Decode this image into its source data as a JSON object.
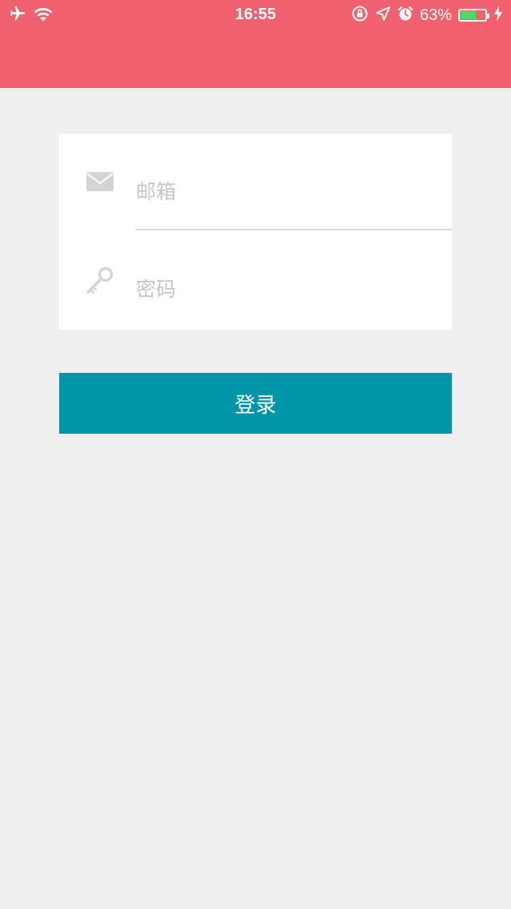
{
  "status_bar": {
    "time": "16:55",
    "battery_percent": "63%",
    "battery_level": 0.63,
    "icons": [
      "airplane-icon",
      "wifi-icon",
      "rotation-lock-icon",
      "location-icon",
      "alarm-icon",
      "battery-icon",
      "charging-icon"
    ]
  },
  "colors": {
    "header": "#f0606f",
    "background": "#efefef",
    "button": "#0095a7",
    "placeholder": "#c5c5c9",
    "battery_fill": "#4cd964"
  },
  "form": {
    "email": {
      "placeholder": "邮箱",
      "value": "",
      "icon": "envelope-icon"
    },
    "password": {
      "placeholder": "密码",
      "value": "",
      "icon": "key-icon"
    }
  },
  "login_button": {
    "label": "登录"
  }
}
